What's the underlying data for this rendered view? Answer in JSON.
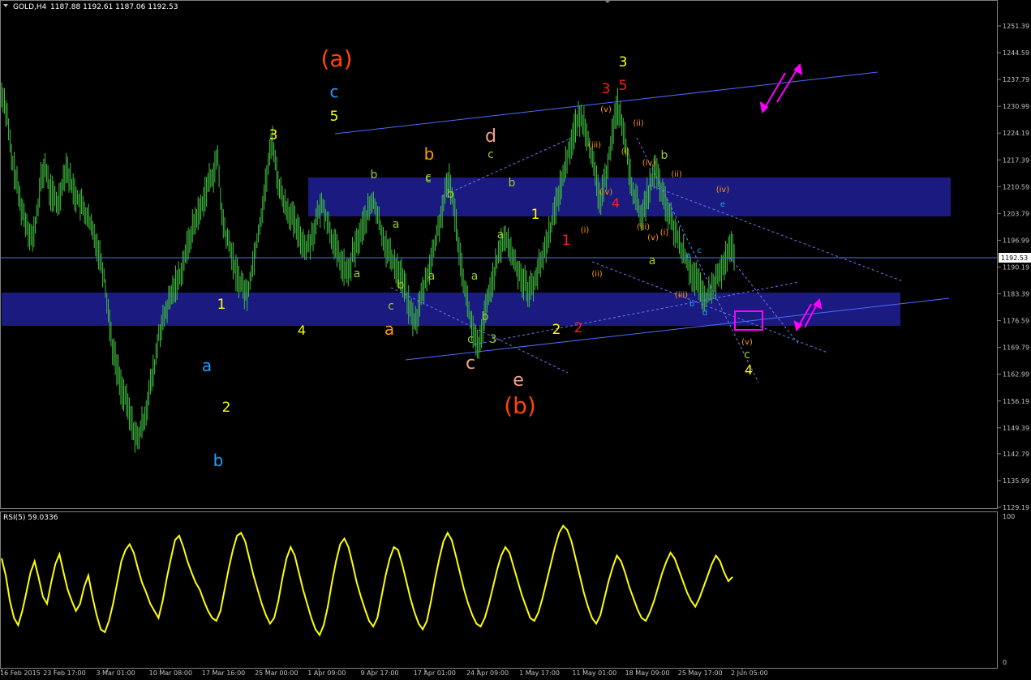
{
  "header": {
    "symbol_label": "GOLD,H4",
    "ohlc": "1187.88 1192.61 1187.06 1192.53"
  },
  "current_price_label": "1192.53",
  "rsi": {
    "label": "RSI(5) 59.0336",
    "scale_top": "100",
    "scale_bottom": "0"
  },
  "colors": {
    "background": "#000000",
    "candles": "#3fbf3f",
    "zone": "#1a1a80",
    "trend_line": "#4d6bff",
    "rsi_line": "#ffff00",
    "axis_text": "#c0c0c0",
    "box": "#ff00ff"
  },
  "chart_data": {
    "type": "line",
    "title": "GOLD,H4",
    "ylim": [
      1126,
      1256
    ],
    "grid": false,
    "y_ticks": [
      "1251.39",
      "1244.59",
      "1237.79",
      "1230.99",
      "1224.19",
      "1217.39",
      "1210.59",
      "1203.79",
      "1196.99",
      "1190.19",
      "1183.39",
      "1176.59",
      "1169.79",
      "1162.99",
      "1156.19",
      "1149.39",
      "1142.79",
      "1135.99",
      "1129.19"
    ],
    "x_ticks": [
      "16 Feb 2015",
      "23 Feb 17:00",
      "3 Mar 01:00",
      "10 Mar 08:00",
      "17 Mar 16:00",
      "25 Mar 00:00",
      "1 Apr 09:00",
      "9 Apr 17:00",
      "17 Apr 01:00",
      "24 Apr 09:00",
      "1 May 17:00",
      "11 May 01:00",
      "18 May 09:00",
      "25 May 17:00",
      "2 Jun 05:00"
    ],
    "series": [
      {
        "values": [
          1234,
          1228,
          1218,
          1213,
          1207,
          1203,
          1200,
          1197,
          1203,
          1212,
          1216,
          1210,
          1208,
          1206,
          1211,
          1216,
          1212,
          1209,
          1207,
          1205,
          1203,
          1200,
          1197,
          1193,
          1188,
          1179,
          1170,
          1165,
          1160,
          1157,
          1153,
          1149,
          1146,
          1150,
          1154,
          1160,
          1165,
          1173,
          1176,
          1180,
          1183,
          1186,
          1188,
          1192,
          1196,
          1200,
          1203,
          1205,
          1209,
          1212,
          1214,
          1218,
          1203,
          1198,
          1195,
          1190,
          1187,
          1185,
          1183,
          1189,
          1195,
          1201,
          1208,
          1216,
          1223,
          1214,
          1209,
          1206,
          1204,
          1202,
          1199,
          1197,
          1195,
          1197,
          1200,
          1204,
          1206,
          1202,
          1198,
          1195,
          1192,
          1190,
          1188,
          1193,
          1196,
          1199,
          1202,
          1205,
          1207,
          1203,
          1199,
          1195,
          1193,
          1191,
          1189,
          1187,
          1182,
          1178,
          1176,
          1181,
          1185,
          1189,
          1193,
          1198,
          1203,
          1208,
          1213,
          1206,
          1198,
          1190,
          1183,
          1177,
          1172,
          1169,
          1175,
          1181,
          1186,
          1190,
          1194,
          1198,
          1196,
          1193,
          1190,
          1188,
          1186,
          1184,
          1186,
          1189,
          1192,
          1196,
          1200,
          1204,
          1209,
          1213,
          1218,
          1222,
          1226,
          1228,
          1227,
          1223,
          1217,
          1211,
          1207,
          1212,
          1219,
          1226,
          1231,
          1227,
          1220,
          1213,
          1208,
          1205,
          1203,
          1208,
          1212,
          1215,
          1211,
          1207,
          1204,
          1201,
          1198,
          1195,
          1193,
          1190,
          1188,
          1186,
          1183,
          1182,
          1184,
          1186,
          1188,
          1190,
          1193,
          1195,
          1192
        ]
      },
      {
        "name": "RSI(5) 59.0336",
        "values": [
          72,
          60,
          42,
          30,
          25,
          35,
          48,
          62,
          70,
          58,
          45,
          40,
          55,
          68,
          75,
          62,
          50,
          42,
          35,
          40,
          52,
          60,
          45,
          32,
          22,
          20,
          28,
          40,
          55,
          70,
          78,
          82,
          76,
          65,
          55,
          48,
          40,
          35,
          30,
          42,
          58,
          72,
          85,
          88,
          80,
          70,
          62,
          55,
          50,
          42,
          35,
          30,
          28,
          35,
          50,
          65,
          78,
          88,
          90,
          84,
          72,
          60,
          50,
          40,
          32,
          26,
          30,
          42,
          58,
          72,
          80,
          74,
          62,
          50,
          40,
          30,
          22,
          18,
          25,
          38,
          55,
          70,
          82,
          86,
          80,
          68,
          55,
          45,
          36,
          28,
          24,
          30,
          45,
          60,
          72,
          80,
          78,
          68,
          56,
          44,
          34,
          26,
          22,
          28,
          42,
          58,
          72,
          84,
          90,
          85,
          74,
          62,
          50,
          40,
          32,
          26,
          24,
          30,
          40,
          52,
          64,
          74,
          80,
          76,
          66,
          56,
          46,
          38,
          30,
          28,
          34,
          44,
          56,
          68,
          80,
          90,
          95,
          92,
          84,
          72,
          60,
          48,
          38,
          30,
          26,
          32,
          44,
          56,
          66,
          74,
          70,
          62,
          52,
          44,
          36,
          30,
          28,
          34,
          42,
          52,
          62,
          70,
          76,
          72,
          64,
          56,
          48,
          42,
          38,
          44,
          52,
          60,
          68,
          74,
          70,
          62,
          56,
          59
        ]
      }
    ],
    "annotations": [
      "(a)",
      "c",
      "5",
      "3",
      "b",
      "a",
      "1",
      "2",
      "a",
      "b",
      "3",
      "4",
      "b",
      "c",
      "a",
      "a",
      "b",
      "a",
      "c",
      "d",
      "c",
      "a",
      "b",
      "b",
      "b",
      "c",
      "c",
      "e",
      "(b)",
      "1",
      "2",
      "a",
      "2",
      "1",
      "3",
      "5",
      "3",
      "(v)",
      "(ii)",
      "(iii)",
      "(iv)",
      "(i)",
      "(ii)",
      "(iv)",
      "4",
      "(iii)",
      "(v)",
      "b",
      "(iv)",
      "(ii)",
      "(i)",
      "e",
      "a",
      "c",
      "(iii)",
      "b",
      "d",
      "(v)",
      "c",
      "4",
      "a",
      "c",
      "b",
      "a",
      "b",
      "(i)",
      "(ii)",
      "(iii)",
      "(iv)",
      "(v)",
      "c",
      "(i)"
    ]
  }
}
